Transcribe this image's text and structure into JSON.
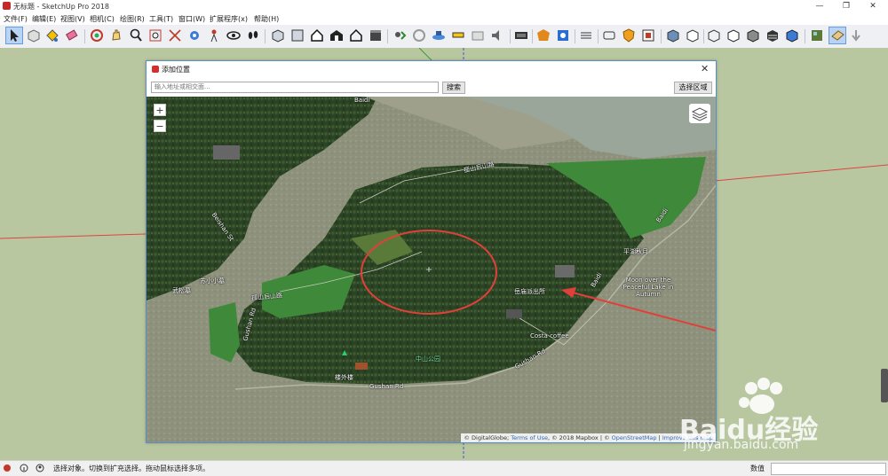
{
  "app": {
    "title": "无标题 - SketchUp Pro 2018"
  },
  "window_controls": {
    "minimize": "—",
    "maximize": "❐",
    "close": "✕"
  },
  "menu": [
    "文件(F)",
    "编辑(E)",
    "视图(V)",
    "相机(C)",
    "绘图(R)",
    "工具(T)",
    "窗口(W)",
    "扩展程序(x)",
    "帮助(H)"
  ],
  "toolbar": {
    "tools": [
      "select-arrow-icon",
      "component-icon",
      "paint-bucket-icon",
      "eraser-icon",
      "orbit-icon",
      "pan-icon",
      "zoom-icon",
      "zoom-window-icon",
      "zoom-extents-icon",
      "position-camera-icon",
      "look-around-icon",
      "walk-icon",
      "iso-view-icon",
      "top-view-icon",
      "front-view-icon",
      "right-view-icon",
      "back-view-icon",
      "left-view-icon",
      "add-location-icon",
      "toggle-terrain-icon",
      "photo-texture-icon",
      "preview-in-google-earth-icon",
      "get-models-icon",
      "share-model-icon",
      "extension-warehouse-icon",
      "layout-icon",
      "style-builder-icon",
      "dynamic-components-icon",
      "interact-icon",
      "warehouse-icon",
      "xray-icon",
      "back-edges-icon",
      "wireframe-icon",
      "hidden-line-icon",
      "shaded-icon",
      "shaded-textures-icon",
      "monochrome-icon",
      "sandbox-from-contours-icon",
      "sandbox-from-scratch-icon",
      "smoove-icon"
    ]
  },
  "dialog": {
    "title": "添加位置",
    "close": "✕",
    "search_placeholder": "输入地址或相交面...",
    "search_button": "搜索",
    "select_region_button": "选择区域",
    "map": {
      "zoom_in": "+",
      "zoom_out": "−",
      "labels": {
        "beishan_st": "Beishan St",
        "gushan_rd_vertical": "Gushan Rd",
        "gushan_rd_bottom": "Gushan Rd",
        "gushan_rd_right": "Gushan Rd",
        "baidi_top": "Baidi",
        "baidi_mid": "Baidi",
        "baidi_right": "Baidi",
        "moon_lake": "Moon over the Peaceful Lake in Autumn",
        "pinghu": "平湖秋月",
        "costa": "Costa coffee",
        "station": "岳庙派出所",
        "zhongshan": "中山公园",
        "louwailou": "楼外楼",
        "suxiaoxiao": "苏小小墓",
        "wusongsheng": "武松墓",
        "lushan1": "孤山后山路",
        "lushan2": "孤山后山路"
      },
      "attribution": {
        "prefix": "© DigitalGlobe; ",
        "terms": "Terms of Use",
        "middle": ", © 2018 Mapbox | © ",
        "osm": "OpenStreetMap",
        "sep": " | ",
        "improve": "Improve this map"
      }
    }
  },
  "status": {
    "message": "选择对象。切换到扩充选择。拖动鼠标选择多项。",
    "value_label": "数值"
  },
  "watermark": {
    "text": "Baidu经验",
    "url": "jingyan.baidu.com"
  },
  "colors": {
    "annotation_red": "#e0403a",
    "axis_red": "#d44",
    "axis_green": "#3a9a3a",
    "axis_blue": "#3a5ad0",
    "ground": "#b9c7a1"
  }
}
